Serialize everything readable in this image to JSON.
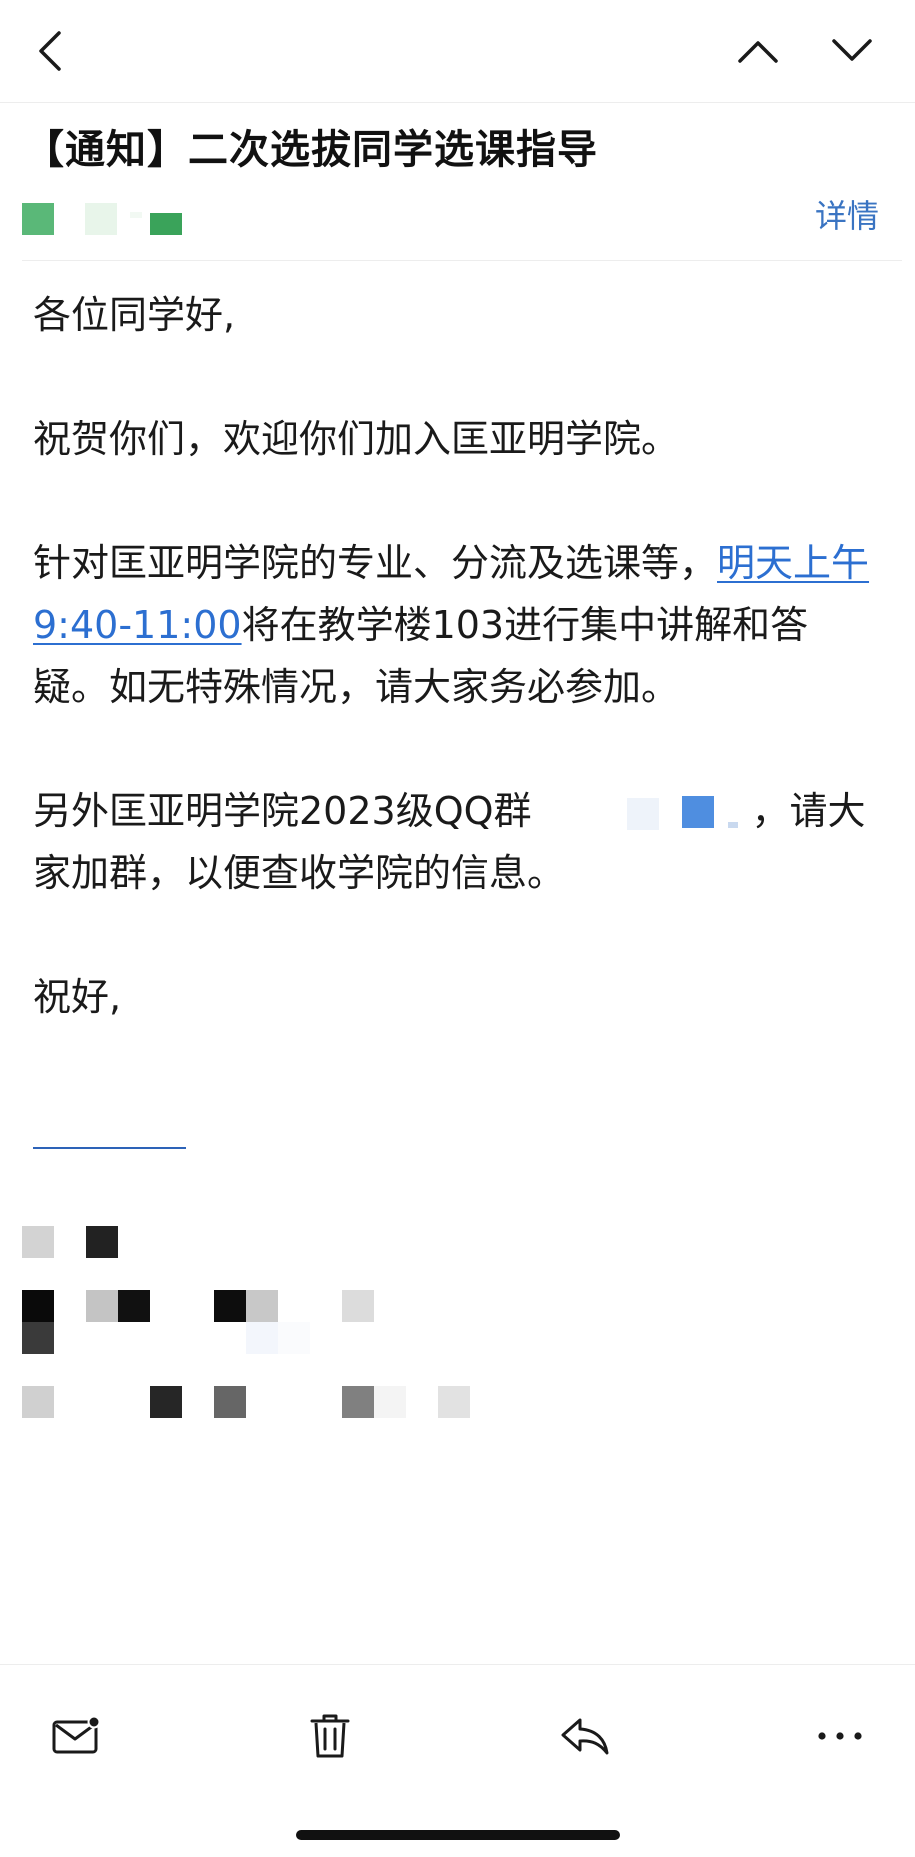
{
  "header": {
    "back_icon": "chevron-left-icon",
    "prev_icon": "chevron-up-icon",
    "next_icon": "chevron-down-icon"
  },
  "email": {
    "subject": "【通知】二次选拔同学选课指导",
    "details_label": "详情",
    "greeting": "各位同学好,",
    "p1": "祝贺你们，欢迎你们加入匡亚明学院。",
    "p2_before": "针对匡亚明学院的专业、分流及选课等，",
    "p2_link": "明天上午9:40-11:00",
    "p2_after": "将在教学楼103进行集中讲解和答疑。如无特殊情况，请大家务必参加。",
    "p3_before": "另外匡亚明学院2023级QQ群",
    "p3_after": "，请大家加群，以便查收学院的信息。",
    "closing": "祝好,"
  },
  "colors": {
    "link": "#2c6fd1",
    "details": "#3a74c2",
    "sender_green": "#3aa35a"
  },
  "toolbar": {
    "mark_icon": "mail-unread-icon",
    "delete_icon": "trash-icon",
    "reply_icon": "reply-icon",
    "more_icon": "more-icon"
  }
}
